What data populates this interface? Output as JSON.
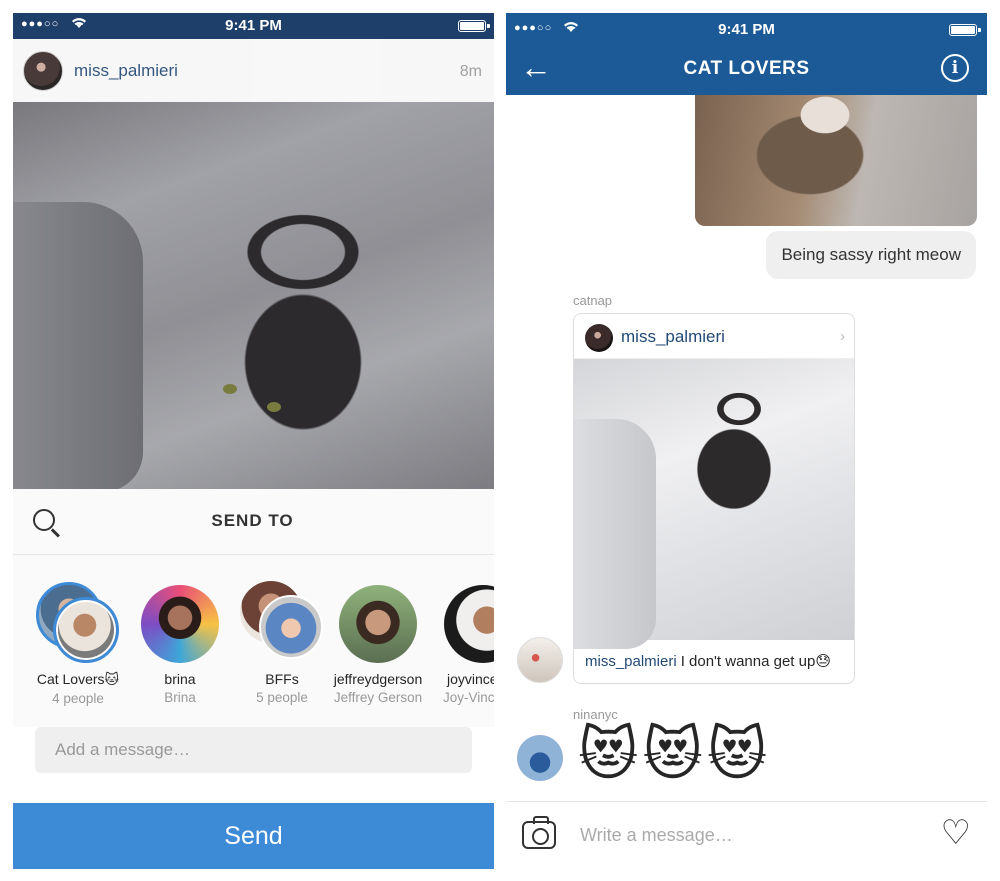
{
  "left": {
    "status_bar": {
      "signal": "●●●○○",
      "time": "9:41 PM"
    },
    "post": {
      "username": "miss_palmieri",
      "time_ago": "8m"
    },
    "send_to": {
      "title": "SEND TO",
      "contacts": [
        {
          "name": "Cat Lovers🐱",
          "sub": "4 people"
        },
        {
          "name": "brina",
          "sub": "Brina"
        },
        {
          "name": "BFFs",
          "sub": "5 people"
        },
        {
          "name": "jeffreydgerson",
          "sub": "Jeffrey Gerson"
        },
        {
          "name": "joyvince",
          "sub": "Joy-Vince"
        }
      ],
      "message_placeholder": "Add a message…",
      "send_label": "Send"
    }
  },
  "right": {
    "status_bar": {
      "signal": "●●●○○",
      "time": "9:41 PM"
    },
    "nav": {
      "back": "←",
      "title": "CAT LOVERS",
      "info": "i"
    },
    "messages": {
      "sassy": "Being sassy right meow",
      "sender1": "catnap",
      "shared_post": {
        "username": "miss_palmieri",
        "caption_user": "miss_palmieri",
        "caption_text": "I don't wanna get up😓"
      },
      "sender2": "ninanyc",
      "emojis": "😻😻😻"
    },
    "compose": {
      "placeholder": "Write a message…"
    }
  },
  "colors": {
    "nav_blue": "#1b5a96",
    "send_blue": "#3d8ad7",
    "username_blue": "#234a75"
  }
}
